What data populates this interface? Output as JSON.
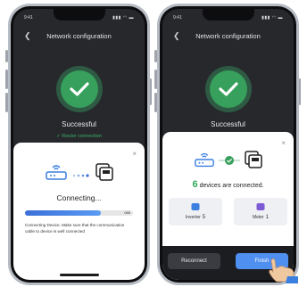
{
  "status_bar": {
    "time": "9:41",
    "icons": "▮▮▮ ◠ ▬"
  },
  "left_phone": {
    "nav_title": "Network configuration",
    "success_title": "Successful",
    "router_connection": "✓ Router connection",
    "sheet": {
      "close_glyph": "×",
      "connecting_title": "Connecting...",
      "progress_label": "085",
      "progress_fraction": 0.7,
      "hint": "Connecting Device, Make sure that the communication cable to device is well connected"
    }
  },
  "right_phone": {
    "nav_title": "Network configuration",
    "success_title": "Successful",
    "sheet": {
      "close_glyph": "×",
      "device_count": "6",
      "devices_text": "devices are connected.",
      "inverter_label": "Inverter",
      "inverter_count": "5",
      "meter_label": "Meter",
      "meter_count": "1",
      "reconnect_label": "Reconnect",
      "finish_label": "Finish"
    }
  },
  "colors": {
    "success_green": "#37a05c",
    "accent_blue": "#4f8ff0",
    "inverter_icon": "#3b7fe0",
    "meter_icon": "#7d5bd6"
  }
}
